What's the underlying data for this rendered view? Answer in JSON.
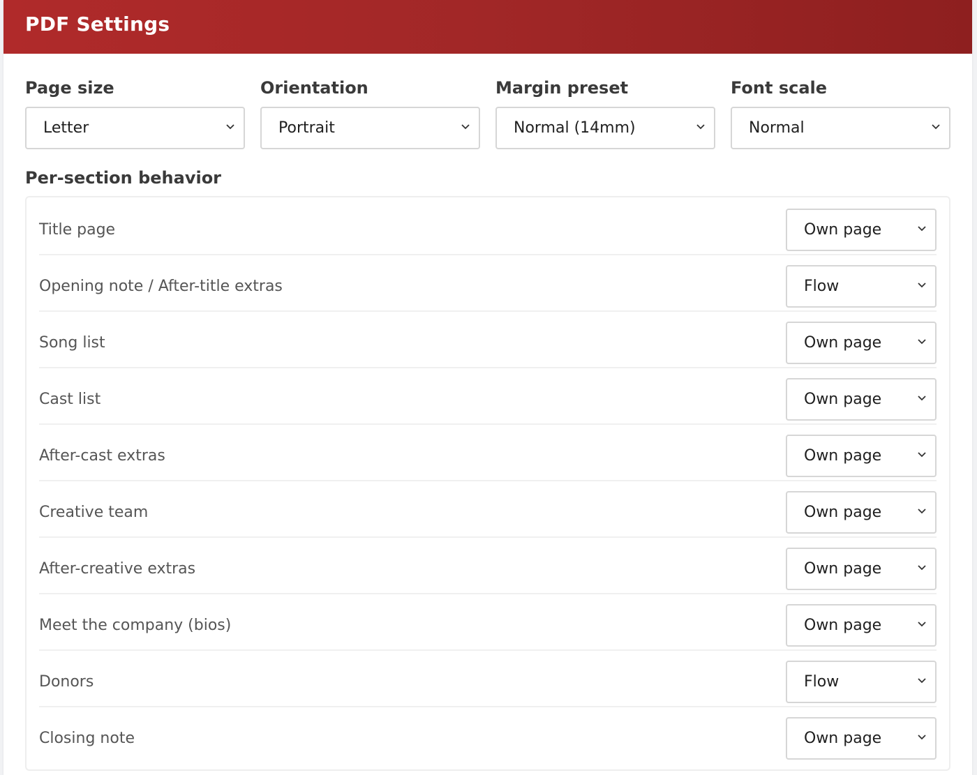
{
  "header": {
    "title": "PDF Settings"
  },
  "colors": {
    "header_bg": "#a62828",
    "header_text": "#ffffff"
  },
  "settings": [
    {
      "label": "Page size",
      "value": "Letter"
    },
    {
      "label": "Orientation",
      "value": "Portrait"
    },
    {
      "label": "Margin preset",
      "value": "Normal (14mm)"
    },
    {
      "label": "Font scale",
      "value": "Normal"
    }
  ],
  "per_section": {
    "heading": "Per-section behavior",
    "rows": [
      {
        "label": "Title page",
        "value": "Own page"
      },
      {
        "label": "Opening note / After-title extras",
        "value": "Flow"
      },
      {
        "label": "Song list",
        "value": "Own page"
      },
      {
        "label": "Cast list",
        "value": "Own page"
      },
      {
        "label": "After-cast extras",
        "value": "Own page"
      },
      {
        "label": "Creative team",
        "value": "Own page"
      },
      {
        "label": "After-creative extras",
        "value": "Own page"
      },
      {
        "label": "Meet the company (bios)",
        "value": "Own page"
      },
      {
        "label": "Donors",
        "value": "Flow"
      },
      {
        "label": "Closing note",
        "value": "Own page"
      }
    ]
  },
  "icons": {
    "dropdown": "chevron-down-icon"
  }
}
